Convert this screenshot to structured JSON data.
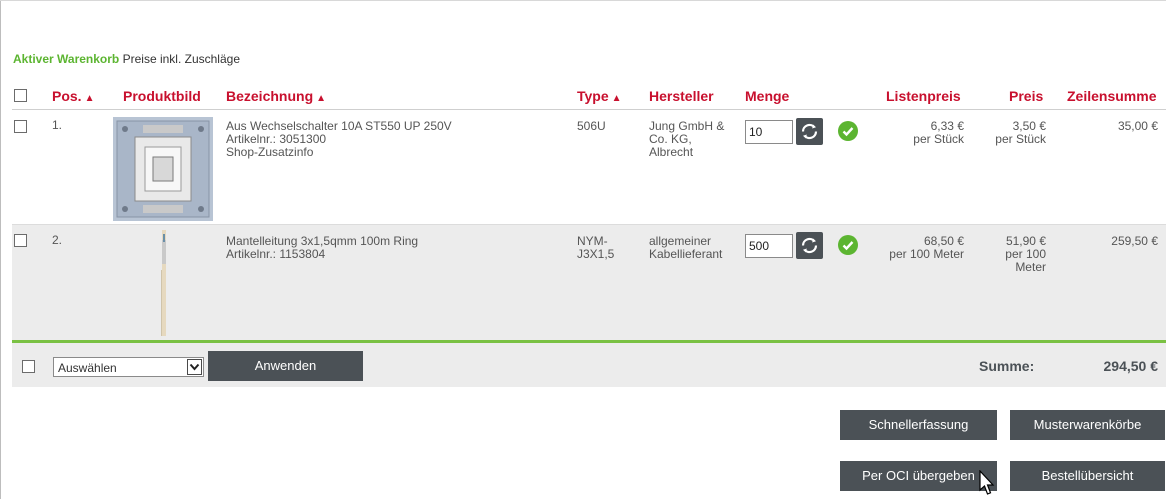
{
  "cart": {
    "active_label": "Aktiver Warenkorb",
    "price_note": "Preise inkl. Zuschläge"
  },
  "columns": {
    "pos": "Pos.",
    "image": "Produktbild",
    "description": "Bezeichnung",
    "type": "Type",
    "manufacturer": "Hersteller",
    "quantity": "Menge",
    "list_price": "Listenpreis",
    "price": "Preis",
    "line_total": "Zeilensumme"
  },
  "items": [
    {
      "pos": "1.",
      "name": "Aus Wechselschalter 10A ST550 UP 250V",
      "article": "Artikelnr.: 3051300",
      "extra": "Shop-Zusatzinfo",
      "type": "506U",
      "manufacturer": [
        "Jung GmbH &",
        "Co. KG,",
        "Albrecht"
      ],
      "quantity": "10",
      "list_price": "6,33 €",
      "list_unit": "per Stück",
      "price": "3,50 €",
      "price_unit": [
        "per Stück"
      ],
      "line_total": "35,00 €"
    },
    {
      "pos": "2.",
      "name": "Mantelleitung 3x1,5qmm 100m Ring",
      "article": "Artikelnr.: 1153804",
      "extra": "",
      "type": [
        "NYM-",
        "J3X1,5"
      ],
      "manufacturer": [
        "allgemeiner",
        "Kabellieferant"
      ],
      "quantity": "500",
      "list_price": "68,50 €",
      "list_unit": "per 100 Meter",
      "price": "51,90 €",
      "price_unit": [
        "per 100",
        "Meter"
      ],
      "line_total": "259,50 €"
    }
  ],
  "footer": {
    "select_value": "Auswählen",
    "apply_button": "Anwenden",
    "sum_label": "Summe:",
    "sum_value": "294,50 €"
  },
  "actions": {
    "quick_entry": "Schnellerfassung",
    "sample_carts": "Musterwarenkörbe",
    "oci_transfer": "Per OCI übergeben",
    "order_overview": "Bestellübersicht"
  },
  "colors": {
    "accent_red": "#c8102e",
    "accent_green": "#5cb531",
    "button_gray": "#4b5156"
  },
  "icons": [
    "refresh-icon",
    "check-circle-icon",
    "sort-icon",
    "chevron-down-icon",
    "mouse-cursor-icon"
  ]
}
